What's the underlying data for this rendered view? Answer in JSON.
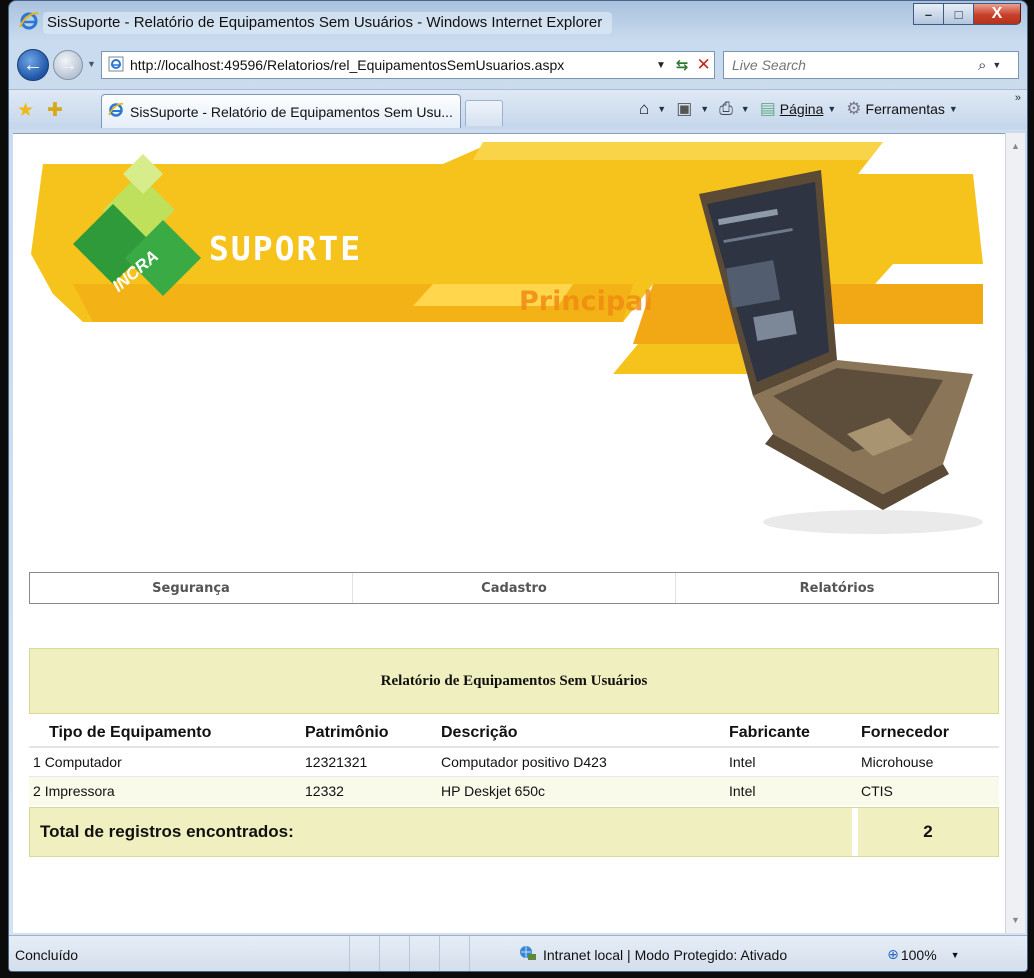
{
  "window": {
    "title": "SisSuporte - Relatório de Equipamentos Sem Usuários - Windows Internet Explorer"
  },
  "address": {
    "url": "http://localhost:49596/Relatorios/rel_EquipamentosSemUsuarios.aspx"
  },
  "search": {
    "placeholder": "Live Search"
  },
  "tab": {
    "label": "SisSuporte - Relatório de Equipamentos Sem Usu..."
  },
  "commandbar": {
    "page_label": "Página",
    "tools_label": "Ferramentas"
  },
  "banner": {
    "logo_text": "INCRA",
    "brand": "SUPORTE",
    "section": "Principal"
  },
  "menu": {
    "items": [
      "Segurança",
      "Cadastro",
      "Relatórios"
    ]
  },
  "report": {
    "title": "Relatório de Equipamentos Sem Usuários",
    "columns": [
      "Tipo de Equipamento",
      "Patrimônio",
      "Descrição",
      "Fabricante",
      "Fornecedor"
    ],
    "rows": [
      {
        "num": "1",
        "tipo": "Computador",
        "patrimonio": "12321321",
        "descricao": "Computador positivo D423",
        "fabricante": "Intel",
        "fornecedor": "Microhouse"
      },
      {
        "num": "2",
        "tipo": "Impressora",
        "patrimonio": "12332",
        "descricao": "HP Deskjet 650c",
        "fabricante": "Intel",
        "fornecedor": "CTIS"
      }
    ],
    "total_label": "Total de registros encontrados:",
    "total_value": "2"
  },
  "status": {
    "text": "Concluído",
    "zone": "Intranet local | Modo Protegido: Ativado",
    "zoom": "100%"
  },
  "colors": {
    "banner_yellow": "#f6c21c",
    "banner_orange": "#f09a12",
    "report_header_bg": "#efefbf",
    "logo_green": "#2e9a3a"
  }
}
